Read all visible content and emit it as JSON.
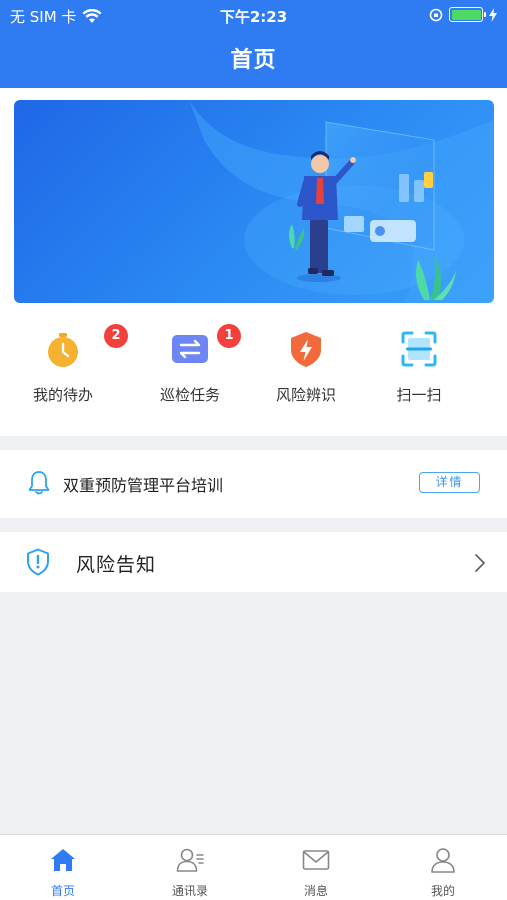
{
  "status_bar": {
    "carrier": "无 SIM 卡",
    "time": "下午2:23",
    "battery_color": "#4cd964"
  },
  "nav": {
    "title": "首页"
  },
  "quick_actions": [
    {
      "label": "我的待办",
      "icon": "clock-icon",
      "badge": "2"
    },
    {
      "label": "巡检任务",
      "icon": "swap-arrows-icon",
      "badge": "1"
    },
    {
      "label": "风险辨识",
      "icon": "lightning-shield-icon",
      "badge": ""
    },
    {
      "label": "扫一扫",
      "icon": "scan-icon",
      "badge": ""
    }
  ],
  "notice": {
    "text": "双重预防管理平台培训",
    "detail_label": "详情",
    "icon": "bell-icon"
  },
  "risk": {
    "text": "风险告知",
    "icon": "alert-shield-icon"
  },
  "tabs": [
    {
      "label": "首页",
      "icon": "home-icon",
      "active": true
    },
    {
      "label": "通讯录",
      "icon": "contacts-icon",
      "active": false
    },
    {
      "label": "消息",
      "icon": "mail-icon",
      "active": false
    },
    {
      "label": "我的",
      "icon": "person-icon",
      "active": false
    }
  ],
  "colors": {
    "primary": "#2f7cf2",
    "badge": "#f2403c",
    "text": "#222222"
  }
}
